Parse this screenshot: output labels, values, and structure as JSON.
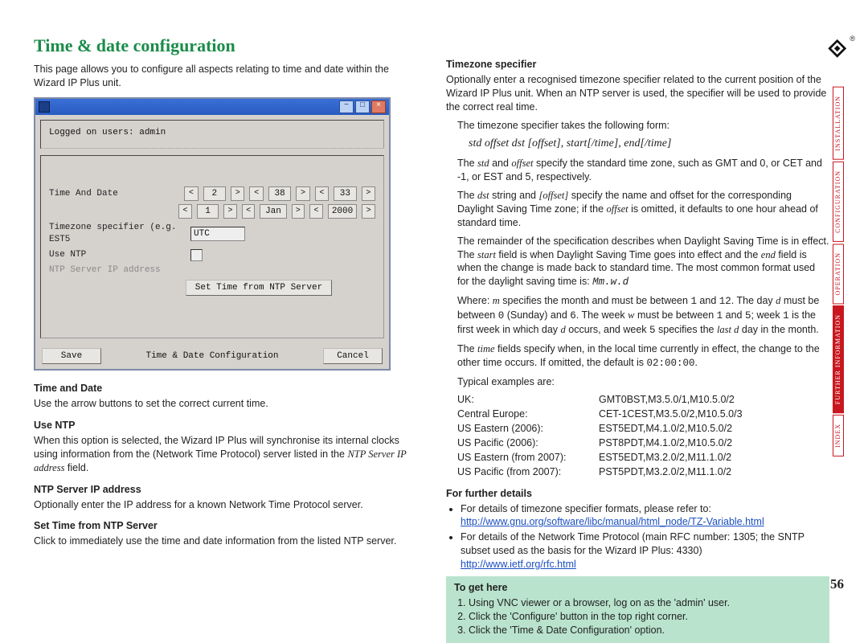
{
  "page_title": "Time & date configuration",
  "intro": "This page allows you to configure all aspects relating to time and date within the Wizard IP Plus unit.",
  "screenshot": {
    "logged_on": "Logged on users: admin",
    "row_time_date_label": "Time And Date",
    "row_tz_label": "Timezone specifier (e.g. EST5",
    "row_use_ntp_label": "Use NTP",
    "row_ntp_ip_label": "NTP Server IP address",
    "btn_set_time": "Set Time from NTP Server",
    "btn_save": "Save",
    "bottom_title": "Time & Date Configuration",
    "btn_cancel": "Cancel",
    "hour": "2",
    "min": "38",
    "sec": "33",
    "day": "1",
    "month": "Jan",
    "year": "2000",
    "tz_value": "UTC",
    "arrow_left": "<",
    "arrow_right": ">",
    "win_min": "−",
    "win_max": "□",
    "win_close": "×"
  },
  "left_sections": {
    "time_date_h": "Time and Date",
    "time_date_p": "Use the arrow buttons to set the correct current time.",
    "use_ntp_h": "Use NTP",
    "use_ntp_p1": "When this option is selected, the Wizard IP Plus will synchronise its internal clocks using information from the (Network Time Protocol) server listed in the ",
    "use_ntp_p2_i": "NTP Server IP address",
    "use_ntp_p3": " field.",
    "ntp_ip_h": "NTP Server IP address",
    "ntp_ip_p": "Optionally enter the IP address for a known Network Time Protocol server.",
    "set_time_h": "Set Time from NTP Server",
    "set_time_p": "Click to immediately use the time and date information from the listed NTP server."
  },
  "right_sections": {
    "tz_h": "Timezone specifier",
    "tz_p1": "Optionally enter a recognised timezone specifier related to the current position of the Wizard IP Plus unit. When an NTP server is used, the specifier will be used to provide the correct real time.",
    "tz_form_intro": "The timezone specifier takes the following form:",
    "tz_form": "std offset dst [offset], start[/time], end[/time]",
    "tz_r1a": "The ",
    "tz_r1b": "std",
    "tz_r1c": " and ",
    "tz_r1d": "offset",
    "tz_r1e": " specify the standard time zone, such as GMT and 0, or CET and -1, or EST and 5, respectively.",
    "tz_r2a": "The ",
    "tz_r2b": "dst",
    "tz_r2c": " string and ",
    "tz_r2d": "[offset]",
    "tz_r2e": " specify the name and offset for the corresponding Daylight Saving Time zone; if the ",
    "tz_r2f": "offset",
    "tz_r2g": " is omitted, it defaults to one hour ahead of standard time.",
    "tz_r3a": "The remainder of the specification describes when Daylight Saving Time is in effect. The ",
    "tz_r3b": "start",
    "tz_r3c": " field is when Daylight Saving Time goes into effect and the ",
    "tz_r3d": "end",
    "tz_r3e": " field is when the change is made back to standard time. The most common format used for the daylight saving time is: ",
    "tz_r3f": "Mm.w.d",
    "tz_r4a": "Where: ",
    "tz_r4b": "m",
    "tz_r4c": " specifies the month and must be between ",
    "tz_r4d": "1",
    "tz_r4e": " and ",
    "tz_r4f": "12",
    "tz_r4g": ". The day ",
    "tz_r4h": "d",
    "tz_r4i": " must be between ",
    "tz_r4j": "0",
    "tz_r4k": " (Sunday) and ",
    "tz_r4l": "6",
    "tz_r4m": ". The week ",
    "tz_r4n": "w",
    "tz_r4o": " must be between ",
    "tz_r4p": "1",
    "tz_r4q": " and ",
    "tz_r4r": "5",
    "tz_r4s": "; week ",
    "tz_r4t": "1",
    "tz_r4u": " is the first week in which day ",
    "tz_r4v": "d",
    "tz_r4w": " occurs, and week ",
    "tz_r4x": "5",
    "tz_r4y": " specifies the ",
    "tz_r4z": "last d",
    "tz_r4za": " day in the month.",
    "tz_r5a": "The ",
    "tz_r5b": "time",
    "tz_r5c": " fields specify when, in the local time currently in effect, the change to the other time occurs. If omitted, the default is ",
    "tz_r5d": "02:00:00",
    "tz_r5e": ".",
    "examples_intro": "Typical examples are:",
    "ex": [
      {
        "k": "UK:",
        "v": "GMT0BST,M3.5.0/1,M10.5.0/2"
      },
      {
        "k": "Central Europe:",
        "v": "CET-1CEST,M3.5.0/2,M10.5.0/3"
      },
      {
        "k": "US Eastern (2006):",
        "v": "EST5EDT,M4.1.0/2,M10.5.0/2"
      },
      {
        "k": "US Pacific (2006):",
        "v": "PST8PDT,M4.1.0/2,M10.5.0/2"
      },
      {
        "k": "US Eastern (from 2007):",
        "v": "EST5EDT,M3.2.0/2,M11.1.0/2"
      },
      {
        "k": "US Pacific (from 2007):",
        "v": "PST5PDT,M3.2.0/2,M11.1.0/2"
      }
    ],
    "further_h": "For further details",
    "further_b1": "For details of timezone specifier formats, please refer to:",
    "further_link1": "http://www.gnu.org/software/libc/manual/html_node/TZ-Variable.html",
    "further_b2a": "For details of the Network Time Protocol (main RFC number: 1305; the SNTP subset used as the basis for the Wizard IP Plus: 4330)",
    "further_link2": "http://www.ietf.org/rfc.html",
    "togethere_h": "To get here",
    "steps": [
      "Using VNC viewer or a browser, log on as the 'admin' user.",
      "Click the 'Configure' button in the top right corner.",
      "Click the 'Time & Date Configuration' option."
    ]
  },
  "sidetabs": [
    "INSTALLATION",
    "CONFIGURATION",
    "OPERATION",
    "FURTHER INFORMATION",
    "INDEX"
  ],
  "page_number": "56",
  "registered": "®"
}
